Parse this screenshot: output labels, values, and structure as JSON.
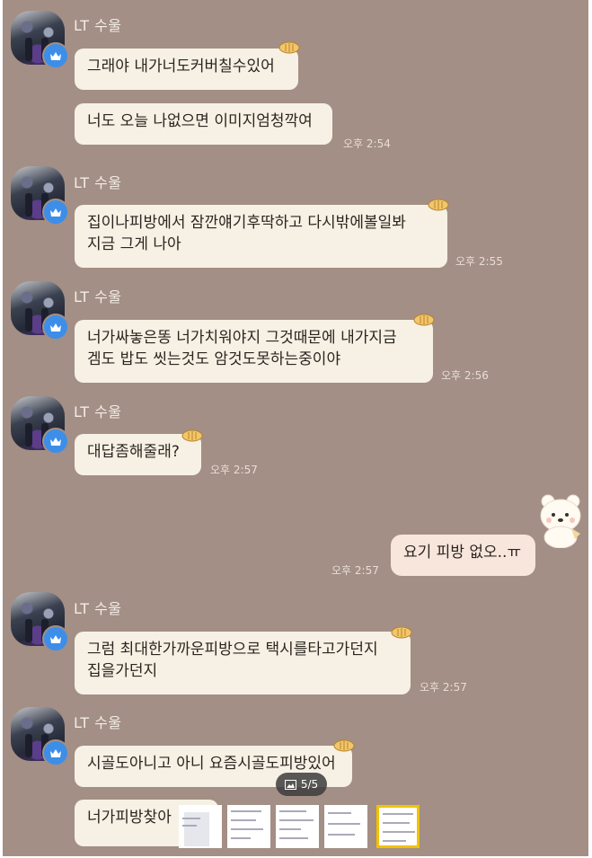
{
  "sender_name": "LT 수울",
  "messages": [
    {
      "text": "그래야 내가너도커버칠수있어",
      "time": ""
    },
    {
      "text": "너도 오늘 나없으면 이미지엄청깍여",
      "time": "오후 2:54"
    },
    {
      "line1": "집이나피방에서 잠깐얘기후딱하고 다시밖에볼일봐",
      "line2": "지금 그게 나아",
      "time": "오후 2:55"
    },
    {
      "line1": "너가싸놓은똥 너가치워야지 그것때문에 내가지금",
      "line2": "겜도 밥도 씻는것도 암것도못하는중이야",
      "time": "오후 2:56"
    },
    {
      "text": "대답좀해줄래?",
      "time": "오후 2:57"
    },
    {
      "text": "요기 피방 없오..ㅠ",
      "time": "오후 2:57"
    },
    {
      "line1": "그럼 최대한가까운피방으로 택시를타고가던지",
      "line2": "집을가던지",
      "time": "오후 2:57"
    },
    {
      "text": "시골도아니고 아니 요즘시골도피방있어",
      "time": ""
    },
    {
      "text": "너가피방찾아",
      "time": ""
    }
  ],
  "viewer": {
    "page_indicator": "5/5",
    "thumbnail_count": 5,
    "selected_thumbnail": 5
  },
  "colors": {
    "background": "#a38f85",
    "bubble": "#f6f1e4",
    "my_bubble": "#f8e6dc",
    "badge": "#3d8ee8",
    "selected_thumb": "#f2c200"
  },
  "icons": {
    "avatar_badge": "crown-icon",
    "reaction": "fish-bread-icon",
    "my_avatar": "bear-sticker-icon",
    "pager": "gallery-icon"
  }
}
